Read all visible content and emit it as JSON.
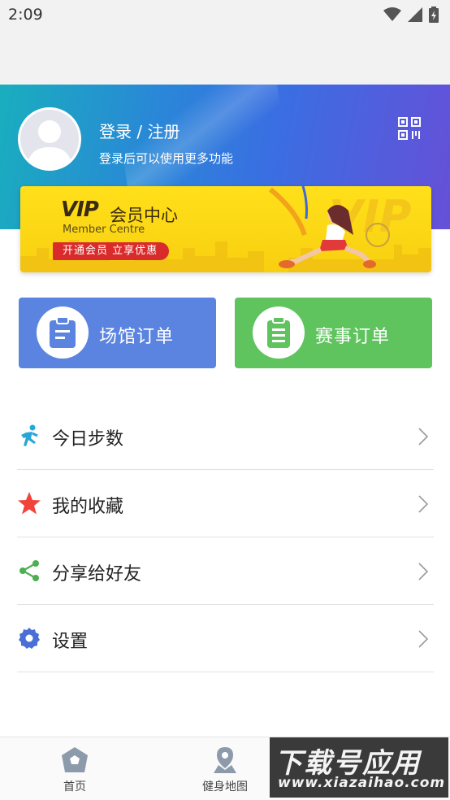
{
  "status_bar": {
    "time": "2:09"
  },
  "profile": {
    "login_title": "登录 / 注册",
    "login_subtitle": "登录后可以使用更多功能"
  },
  "vip": {
    "logo": "VIP",
    "title": "会员中心",
    "subtitle_en": "Member Centre",
    "promo": "开通会员  立享优惠",
    "background_text": "VIP"
  },
  "orders": [
    {
      "label": "场馆订单",
      "color": "#5b84e0",
      "icon": "clipboard-icon"
    },
    {
      "label": "赛事订单",
      "color": "#5fc35e",
      "icon": "list-clipboard-icon"
    }
  ],
  "menu": [
    {
      "label": "今日步数",
      "icon": "running-icon",
      "color": "#27a7d8"
    },
    {
      "label": "我的收藏",
      "icon": "star-icon",
      "color": "#f0443b"
    },
    {
      "label": "分享给好友",
      "icon": "share-icon",
      "color": "#4caf50"
    },
    {
      "label": "设置",
      "icon": "gear-icon",
      "color": "#4a6fd6"
    }
  ],
  "bottom_nav": [
    {
      "label": "首页",
      "icon": "home-icon"
    },
    {
      "label": "健身地图",
      "icon": "map-pin-icon"
    }
  ],
  "watermark": {
    "main": "下载号应用",
    "url": "www.xiazaihao.com"
  },
  "colors": {
    "header_gradient_start": "#19aebe",
    "header_gradient_end": "#6650d8",
    "vip_yellow": "#ffe01a",
    "promo_red": "#d92b2b"
  }
}
